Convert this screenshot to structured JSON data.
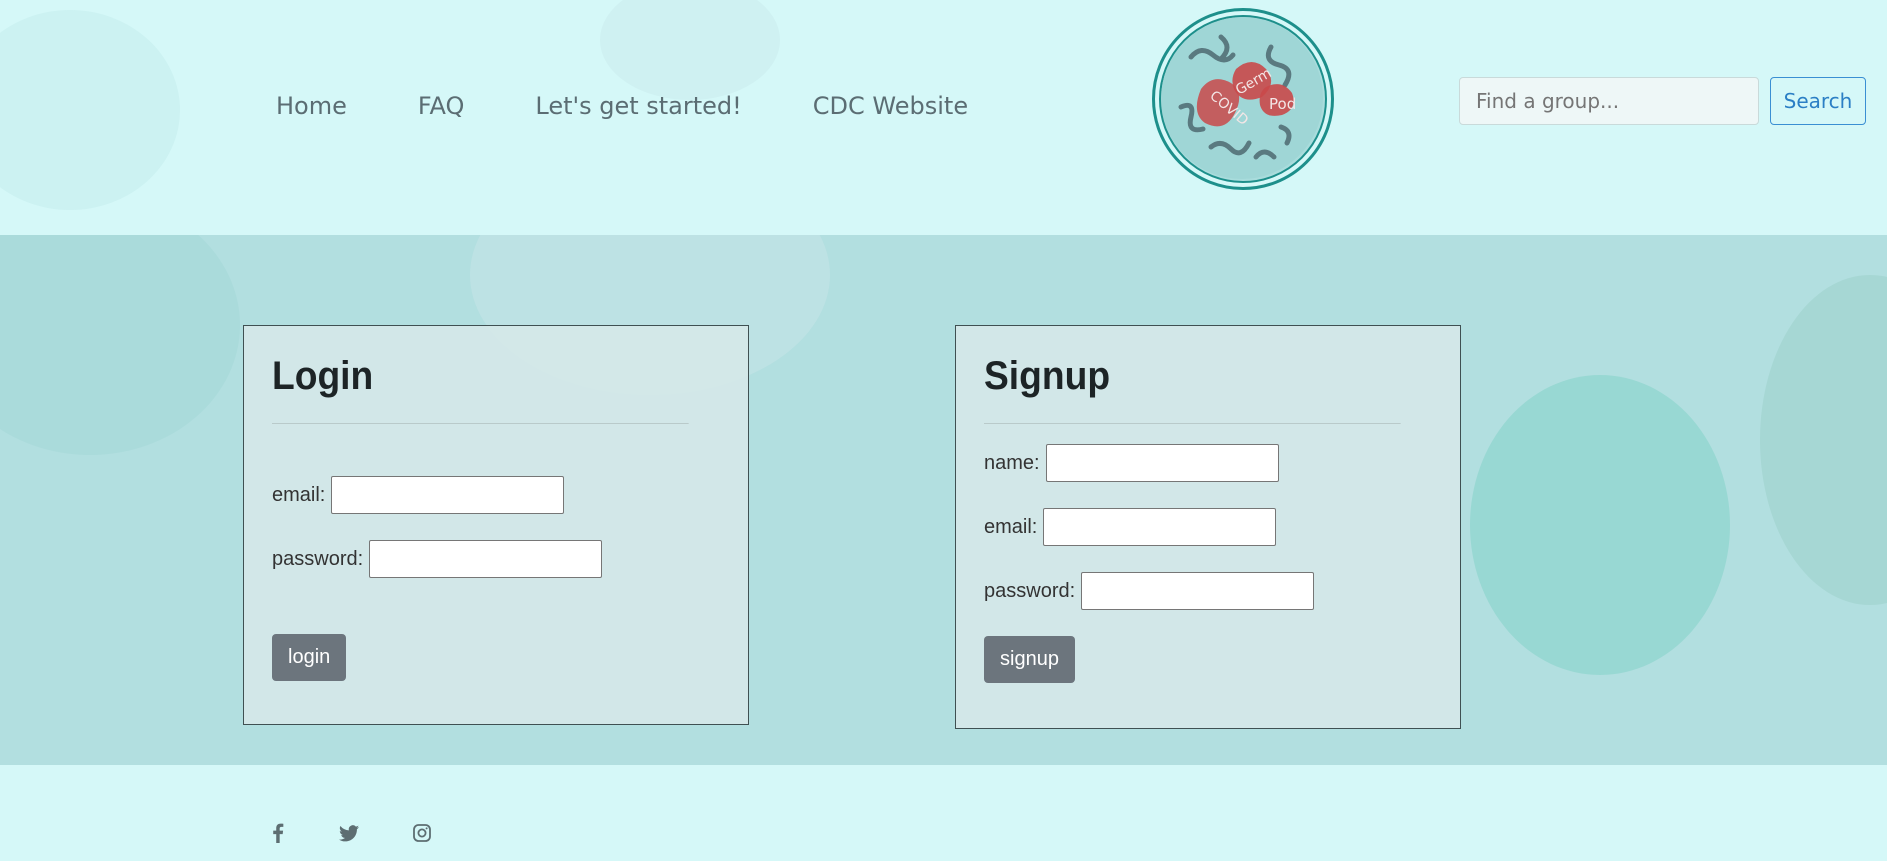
{
  "nav": {
    "items": [
      {
        "label": "Home"
      },
      {
        "label": "FAQ"
      },
      {
        "label": "Let's get started!"
      },
      {
        "label": "CDC Website"
      }
    ]
  },
  "logo": {
    "words": [
      "Germ",
      "Pod",
      "COVID"
    ]
  },
  "search": {
    "placeholder": "Find a group...",
    "button": "Search"
  },
  "login": {
    "title": "Login",
    "email_label": "email:",
    "password_label": "password:",
    "button": "login"
  },
  "signup": {
    "title": "Signup",
    "name_label": "name:",
    "email_label": "email:",
    "password_label": "password:",
    "button": "signup"
  },
  "footer": {
    "social": [
      "facebook-icon",
      "twitter-icon",
      "instagram-icon"
    ]
  },
  "colors": {
    "accent": "#1d8f8b",
    "button": "#6c757d",
    "search_blue": "#2b7fc5"
  }
}
